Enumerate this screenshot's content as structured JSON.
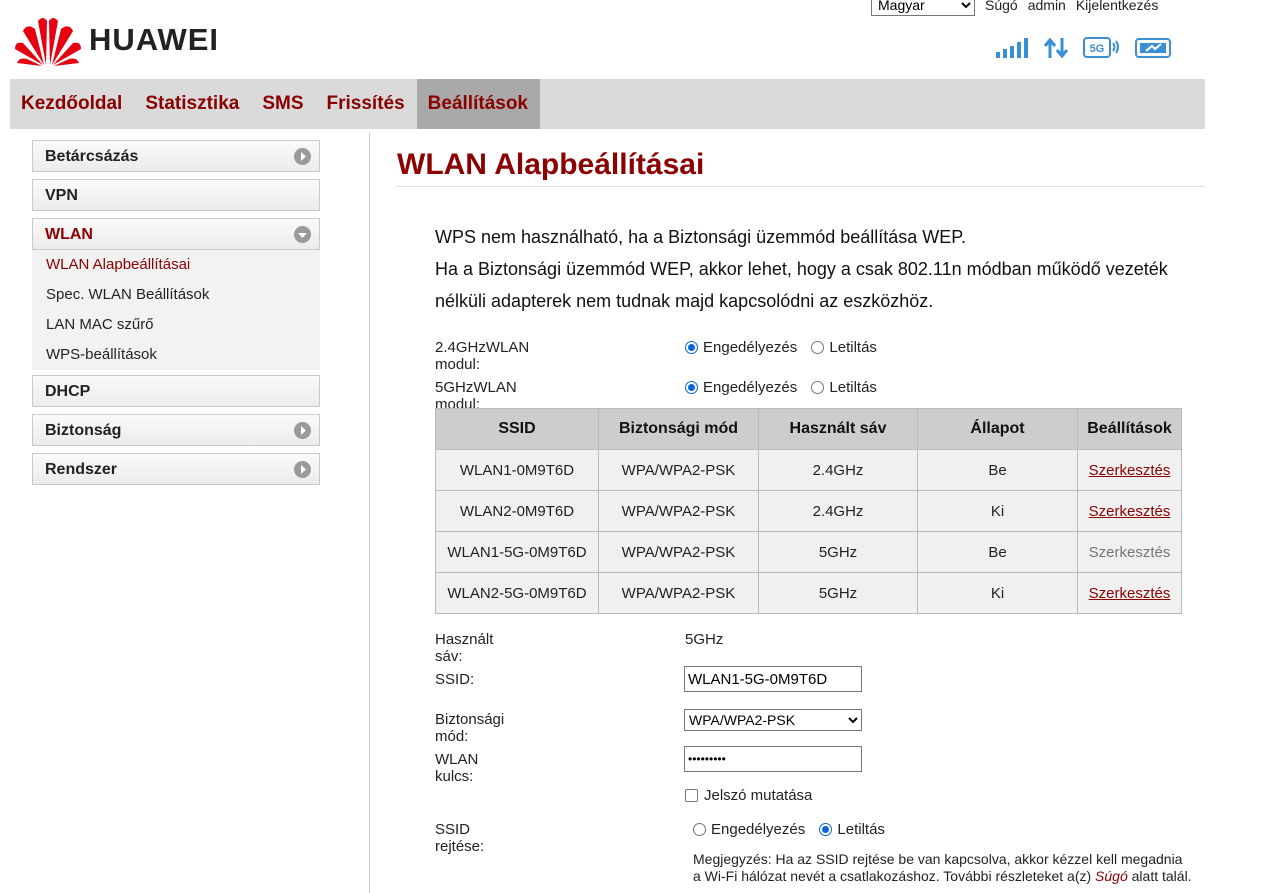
{
  "brand": {
    "name": "HUAWEI"
  },
  "topbar": {
    "language": "Magyar",
    "help": "Súgó",
    "user": "admin",
    "logout": "Kijelentkezés"
  },
  "nav": [
    {
      "label": "Kezdőoldal",
      "active": false
    },
    {
      "label": "Statisztika",
      "active": false
    },
    {
      "label": "SMS",
      "active": false
    },
    {
      "label": "Frissítés",
      "active": false
    },
    {
      "label": "Beállítások",
      "active": true
    }
  ],
  "sidebar": {
    "items": [
      {
        "label": "Betárcsázás"
      },
      {
        "label": "VPN"
      },
      {
        "label": "WLAN"
      },
      {
        "label": "DHCP"
      },
      {
        "label": "Biztonság"
      },
      {
        "label": "Rendszer"
      }
    ],
    "wlan_sub": [
      {
        "label": "WLAN Alapbeállításai"
      },
      {
        "label": "Spec. WLAN Beállítások"
      },
      {
        "label": "LAN MAC szűrő"
      },
      {
        "label": "WPS-beállítások"
      }
    ]
  },
  "page": {
    "title": "WLAN Alapbeállításai",
    "notice_1": "WPS nem használható, ha a Biztonsági üzemmód beállítása WEP.",
    "notice_2": "Ha a Biztonsági üzemmód WEP, akkor lehet, hogy a csak 802.11n módban működő vezeték nélküli adapterek nem tudnak majd kapcsolódni az eszközhöz.",
    "module_24_label": "2.4GHzWLAN modul:",
    "module_5_label": "5GHzWLAN modul:",
    "enable": "Engedélyezés",
    "disable": "Letiltás"
  },
  "table": {
    "headers": [
      "SSID",
      "Biztonsági mód",
      "Használt sáv",
      "Állapot",
      "Beállítások"
    ],
    "rows": [
      [
        "WLAN1-0M9T6D",
        "WPA/WPA2-PSK",
        "2.4GHz",
        "Be",
        "Szerkesztés"
      ],
      [
        "WLAN2-0M9T6D",
        "WPA/WPA2-PSK",
        "2.4GHz",
        "Ki",
        "Szerkesztés"
      ],
      [
        "WLAN1-5G-0M9T6D",
        "WPA/WPA2-PSK",
        "5GHz",
        "Be",
        "Szerkesztés"
      ],
      [
        "WLAN2-5G-0M9T6D",
        "WPA/WPA2-PSK",
        "5GHz",
        "Ki",
        "Szerkesztés"
      ]
    ]
  },
  "form": {
    "band_label": "Használt sáv:",
    "band_value": "5GHz",
    "ssid_label": "SSID:",
    "ssid_value": "WLAN1-5G-0M9T6D",
    "security_label": "Biztonsági mód:",
    "security_value": "WPA/WPA2-PSK",
    "key_label": "WLAN kulcs:",
    "key_value": "•••••••••",
    "show_password": "Jelszó mutatása",
    "hide_ssid_label": "SSID rejtése:",
    "hide_enable": "Engedélyezés",
    "hide_disable": "Letiltás",
    "note_text": "Megjegyzés: Ha az SSID rejtése be van kapcsolva, akkor kézzel kell megadnia a Wi-Fi hálózat nevét a csatlakozáshoz. További részleteket a(z) ",
    "note_link": "Súgó",
    "note_tail": " alatt talál."
  },
  "colors": {
    "accent": "#8b0000",
    "nav_bg": "#dadada",
    "radio_blue": "#0b63d8"
  }
}
